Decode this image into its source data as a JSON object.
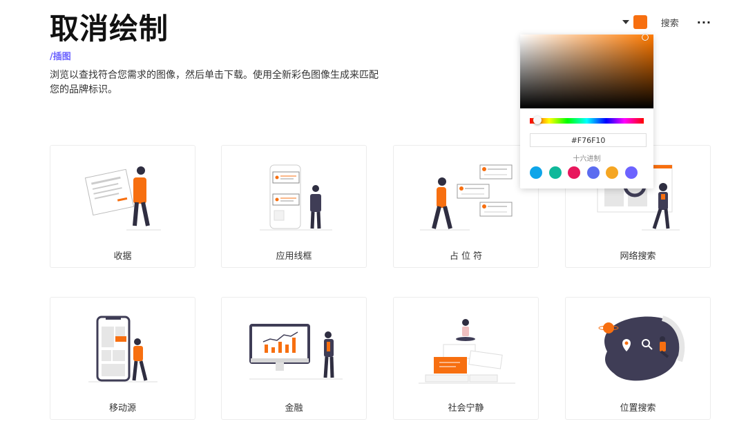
{
  "header": {
    "title": "取消绘制",
    "breadcrumb": "/插图",
    "description": "浏览以查找符合您需求的图像，然后单击下载。使用全新彩色图像生成来匹配您的品牌标识。"
  },
  "topbar": {
    "accent_color": "#F76F10",
    "search_label": "搜索",
    "more_label": "···"
  },
  "color_picker": {
    "hex_value": "#F76F10",
    "hex_label": "十六进制",
    "hue_color": "#ff7a00",
    "presets": [
      "#0ea5e9",
      "#10b89a",
      "#e8175d",
      "#5b6cf0",
      "#f5a623",
      "#6c63ff"
    ]
  },
  "cards": [
    {
      "label": "收据",
      "icon": "receipt-illustration"
    },
    {
      "label": "应用线框",
      "icon": "app-wireframe-illustration"
    },
    {
      "label": "占 位 符",
      "icon": "placeholders-illustration"
    },
    {
      "label": "网络搜索",
      "icon": "web-search-illustration"
    },
    {
      "label": "移动源",
      "icon": "mobile-feed-illustration"
    },
    {
      "label": "金融",
      "icon": "finance-illustration"
    },
    {
      "label": "社会宁静",
      "icon": "social-serenity-illustration"
    },
    {
      "label": "位置搜索",
      "icon": "location-search-illustration"
    }
  ]
}
